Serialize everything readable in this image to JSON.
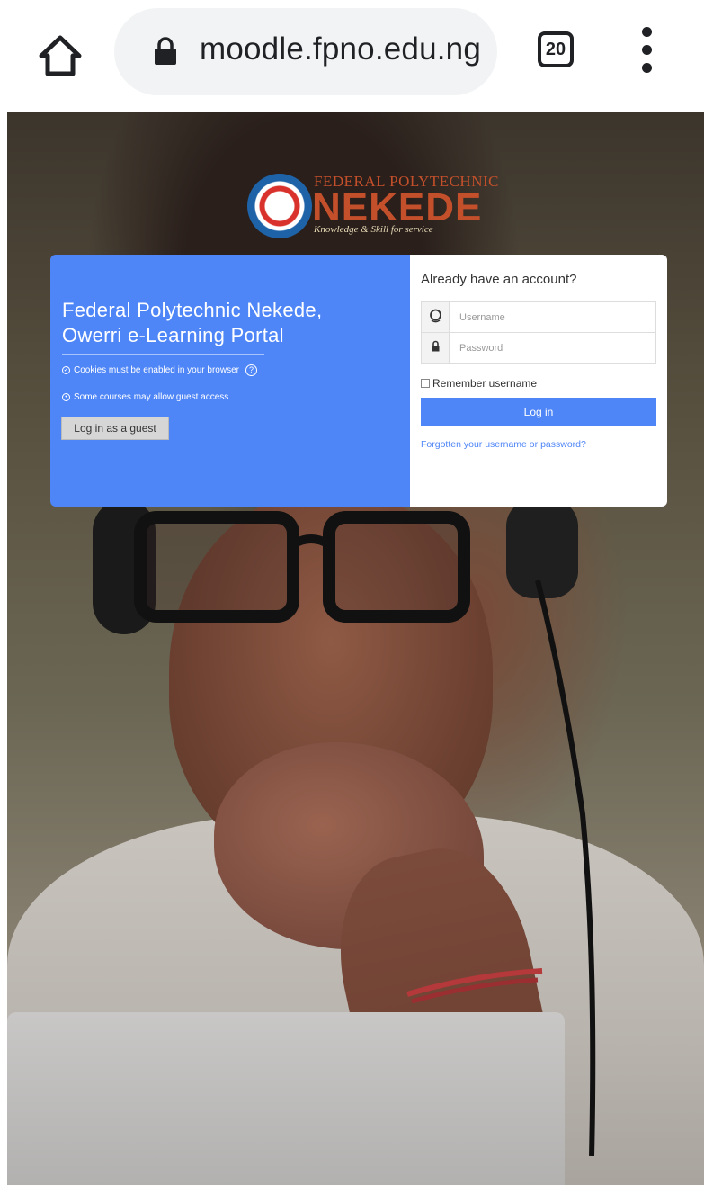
{
  "browser": {
    "url": "moodle.fpno.edu.ng",
    "tab_count": "20",
    "icons": {
      "home": "home-icon",
      "lock": "lock-icon",
      "menu": "more-vert-icon"
    }
  },
  "logo": {
    "top_line": "FEDERAL POLYTECHNIC",
    "main": "NEKEDE",
    "tagline": "Knowledge & Skill for service"
  },
  "login_info": {
    "title": "Federal Polytechnic Nekede, Owerri e-Learning Portal",
    "cookies_note": "Cookies must be enabled in your browser",
    "guest_note": "Some courses may allow guest access",
    "guest_button": "Log in as a guest"
  },
  "login_form": {
    "heading": "Already have an account?",
    "username_placeholder": "Username",
    "password_placeholder": "Password",
    "remember_label": "Remember username",
    "login_button": "Log in",
    "forgot_link": "Forgotten your username or password?"
  },
  "colors": {
    "accent": "#4f86f7",
    "logo": "#c4502b"
  }
}
